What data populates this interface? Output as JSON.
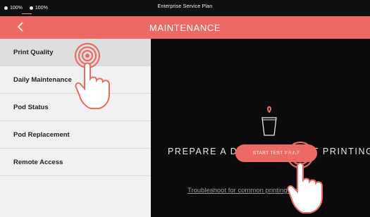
{
  "status_bar": {
    "left_items": [
      "100%",
      "100%"
    ],
    "title": "Enterprise Service Plan"
  },
  "nav": {
    "back_icon": "chevron-left-icon",
    "title": "MAINTENANCE"
  },
  "sidebar": {
    "items": [
      {
        "label": "Print Quality",
        "active": true
      },
      {
        "label": "Daily Maintenance"
      },
      {
        "label": "Pod Status"
      },
      {
        "label": "Pod Replacement"
      },
      {
        "label": "Remote Access"
      }
    ]
  },
  "main": {
    "icon": "cup-icon",
    "prompt": "PREPARE A DRINK FOR TEST PRINTING",
    "button_label": "START TEST PRINT",
    "link": "Troubleshoot for common printing problems"
  },
  "overlays": {
    "pointer_icon": "tap-hand-icon"
  },
  "colors": {
    "accent": "#ec6a63",
    "nav_bg": "#ec6a63",
    "status_bg": "#0f0f0f",
    "main_bg": "#0b0b0b",
    "sidebar_bg": "#f1f1f1"
  }
}
